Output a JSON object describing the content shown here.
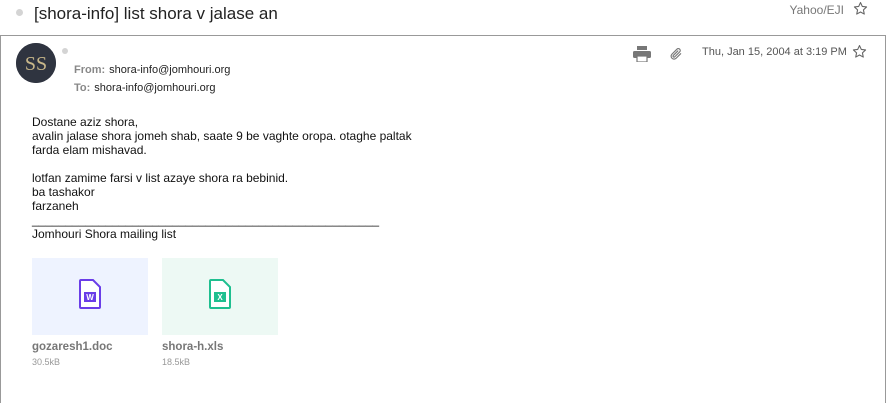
{
  "message": {
    "subject": "[shora-info] list shora v jalase an",
    "folder": "Yahoo/EJI",
    "from_label": "From:",
    "from": "shora-info@jomhouri.org",
    "to_label": "To:",
    "to": "shora-info@jomhouri.org",
    "date": "Thu, Jan 15, 2004 at 3:19 PM",
    "body_lines": [
      "Dostane aziz shora,",
      "avalin jalase shora jomeh shab, saate 9 be vaghte oropa. otaghe paltak",
      "farda elam mishavad.",
      "",
      "lotfan zamime farsi v list azaye shora ra bebinid.",
      "ba tashakor",
      "farzaneh",
      "____________________________________________________",
      "Jomhouri Shora mailing list"
    ]
  },
  "attachments": [
    {
      "name": "gozaresh1.doc",
      "size": "30.5kB",
      "type": "word-document-icon",
      "color": "#6a3de8"
    },
    {
      "name": "shora-h.xls",
      "size": "18.5kB",
      "type": "excel-spreadsheet-icon",
      "color": "#1fbf8f"
    }
  ]
}
